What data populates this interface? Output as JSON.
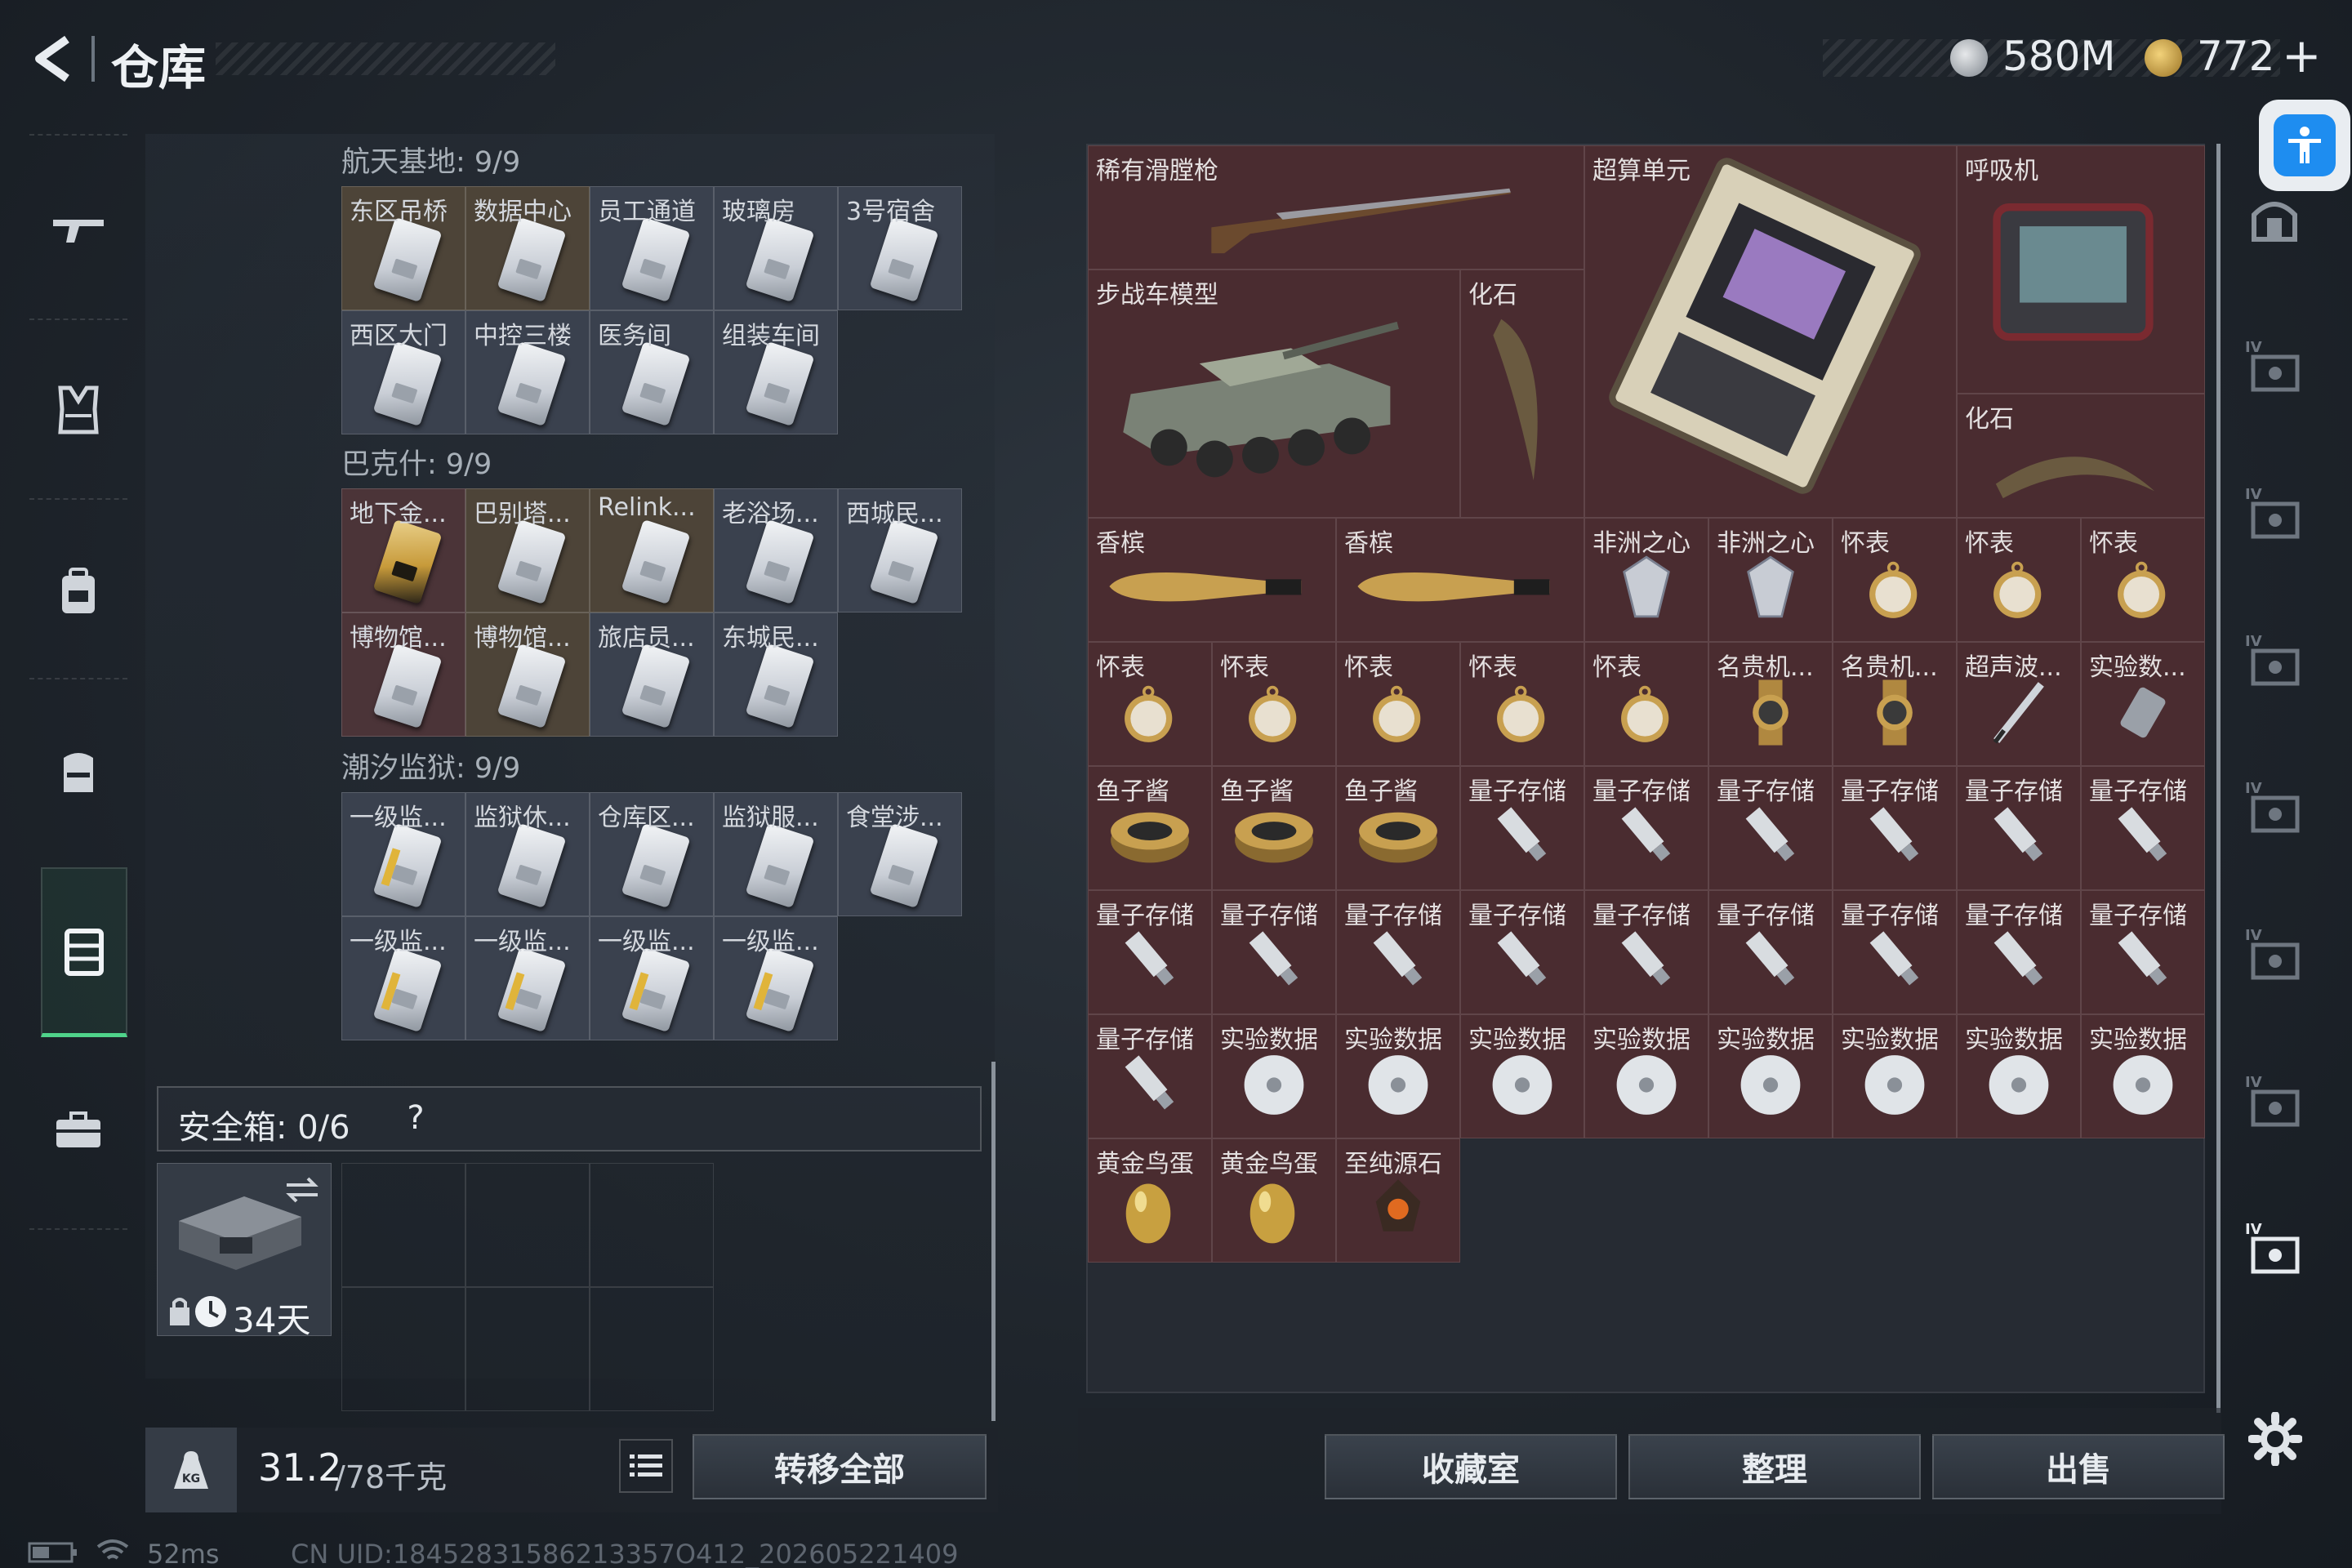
{
  "header": {
    "title": "仓库",
    "currency1_value": "580M",
    "currency2_value": "772",
    "currency2_plus": "+"
  },
  "left_nav": {
    "items": [
      {
        "name": "weapon-icon",
        "glyph": "gun"
      },
      {
        "name": "vest-icon",
        "glyph": "vest"
      },
      {
        "name": "backpack-icon",
        "glyph": "pack"
      },
      {
        "name": "rig-icon",
        "glyph": "rig"
      },
      {
        "name": "storage-icon",
        "glyph": "case"
      },
      {
        "name": "briefcase-icon",
        "glyph": "briefcase"
      }
    ]
  },
  "groups": [
    {
      "title": "航天基地: 9/9",
      "cards": [
        {
          "label": "东区吊桥",
          "style": "gold"
        },
        {
          "label": "数据中心",
          "style": "gold"
        },
        {
          "label": "员工通道",
          "style": "gray"
        },
        {
          "label": "玻璃房",
          "style": "gray"
        },
        {
          "label": "3号宿舍",
          "style": "gray"
        },
        {
          "label": "西区大门",
          "style": "gray"
        },
        {
          "label": "中控三楼",
          "style": "gray"
        },
        {
          "label": "医务间",
          "style": "gray"
        },
        {
          "label": "组装车间",
          "style": "gray"
        }
      ]
    },
    {
      "title": "巴克什: 9/9",
      "cards": [
        {
          "label": "地下金...",
          "style": "red",
          "card": "gold"
        },
        {
          "label": "巴别塔...",
          "style": "gold"
        },
        {
          "label": "Relink...",
          "style": "gold"
        },
        {
          "label": "老浴场...",
          "style": "gray"
        },
        {
          "label": "西城民...",
          "style": "gray"
        },
        {
          "label": "博物馆...",
          "style": "red"
        },
        {
          "label": "博物馆...",
          "style": "gold"
        },
        {
          "label": "旅店员...",
          "style": "gray"
        },
        {
          "label": "东城民...",
          "style": "gray"
        }
      ]
    },
    {
      "title": "潮汐监狱: 9/9",
      "cards": [
        {
          "label": "一级监...",
          "style": "gray",
          "card": "stripe"
        },
        {
          "label": "监狱休...",
          "style": "gray"
        },
        {
          "label": "仓库区...",
          "style": "gray"
        },
        {
          "label": "监狱服...",
          "style": "gray"
        },
        {
          "label": "食堂涉...",
          "style": "gray"
        },
        {
          "label": "一级监...",
          "style": "gray",
          "card": "stripe"
        },
        {
          "label": "一级监...",
          "style": "gray",
          "card": "stripe"
        },
        {
          "label": "一级监...",
          "style": "gray",
          "card": "stripe"
        },
        {
          "label": "一级监...",
          "style": "gray",
          "card": "stripe"
        }
      ]
    }
  ],
  "safe_box": {
    "label": "安全箱: 0/6",
    "help": "?",
    "days": "34天"
  },
  "bottom_left": {
    "weight_current": "31.2",
    "weight_total": "/78千克",
    "transfer_all": "转移全部"
  },
  "status_bar": {
    "ping": "52ms",
    "uid": "CN UID:18452831586213357O412_202605221409"
  },
  "inventory": {
    "items": [
      {
        "label": "稀有滑膛枪",
        "type": "rifle"
      },
      {
        "label": "超算单元",
        "type": "board"
      },
      {
        "label": "呼吸机",
        "type": "ventilator"
      },
      {
        "label": "步战车模型",
        "type": "tank"
      },
      {
        "label": "化石",
        "type": "fossil"
      },
      {
        "label": "化石",
        "type": "fossil2"
      },
      {
        "label": "香槟",
        "type": "champagne"
      },
      {
        "label": "香槟",
        "type": "champagne"
      },
      {
        "label": "非洲之心",
        "type": "diamond"
      },
      {
        "label": "非洲之心",
        "type": "diamond"
      },
      {
        "label": "怀表",
        "type": "watch"
      },
      {
        "label": "怀表",
        "type": "watch"
      },
      {
        "label": "怀表",
        "type": "watch"
      },
      {
        "label": "怀表",
        "type": "watch"
      },
      {
        "label": "怀表",
        "type": "watch"
      },
      {
        "label": "怀表",
        "type": "watch"
      },
      {
        "label": "怀表",
        "type": "watch"
      },
      {
        "label": "怀表",
        "type": "watch"
      },
      {
        "label": "名贵机...",
        "type": "wristwatch"
      },
      {
        "label": "名贵机...",
        "type": "wristwatch"
      },
      {
        "label": "超声波...",
        "type": "pen"
      },
      {
        "label": "实验数...",
        "type": "device"
      },
      {
        "label": "鱼子酱",
        "type": "caviar"
      },
      {
        "label": "鱼子酱",
        "type": "caviar"
      },
      {
        "label": "鱼子酱",
        "type": "caviar"
      },
      {
        "label": "量子存储",
        "type": "usb"
      },
      {
        "label": "量子存储",
        "type": "usb"
      },
      {
        "label": "量子存储",
        "type": "usb"
      },
      {
        "label": "量子存储",
        "type": "usb"
      },
      {
        "label": "量子存储",
        "type": "usb"
      },
      {
        "label": "量子存储",
        "type": "usb"
      },
      {
        "label": "量子存储",
        "type": "usb"
      },
      {
        "label": "量子存储",
        "type": "usb"
      },
      {
        "label": "量子存储",
        "type": "usb"
      },
      {
        "label": "量子存储",
        "type": "usb"
      },
      {
        "label": "量子存储",
        "type": "usb"
      },
      {
        "label": "量子存储",
        "type": "usb"
      },
      {
        "label": "量子存储",
        "type": "usb"
      },
      {
        "label": "量子存储",
        "type": "usb"
      },
      {
        "label": "量子存储",
        "type": "usb"
      },
      {
        "label": "量子存储",
        "type": "usb"
      },
      {
        "label": "实验数据",
        "type": "disc"
      },
      {
        "label": "实验数据",
        "type": "disc"
      },
      {
        "label": "实验数据",
        "type": "disc"
      },
      {
        "label": "实验数据",
        "type": "disc"
      },
      {
        "label": "实验数据",
        "type": "disc"
      },
      {
        "label": "实验数据",
        "type": "disc"
      },
      {
        "label": "实验数据",
        "type": "disc"
      },
      {
        "label": "实验数据",
        "type": "disc"
      },
      {
        "label": "黄金鸟蛋",
        "type": "egg"
      },
      {
        "label": "黄金鸟蛋",
        "type": "egg"
      },
      {
        "label": "至纯源石",
        "type": "gem"
      }
    ]
  },
  "bottom_buttons": {
    "collection": "收藏室",
    "sort": "整理",
    "sell": "出售"
  },
  "right_nav": {
    "items": [
      {
        "name": "armor-icon"
      },
      {
        "name": "container-iv-icon"
      },
      {
        "name": "container-iv-icon"
      },
      {
        "name": "container-v-icon"
      },
      {
        "name": "container-iv-icon"
      },
      {
        "name": "container-iv-icon"
      },
      {
        "name": "container-iv-icon"
      },
      {
        "name": "container-iv-icon"
      }
    ]
  },
  "colors": {
    "accent_green": "#4fd38a",
    "item_bg": "#4a2c30",
    "accessibility_blue": "#1e8df0"
  }
}
